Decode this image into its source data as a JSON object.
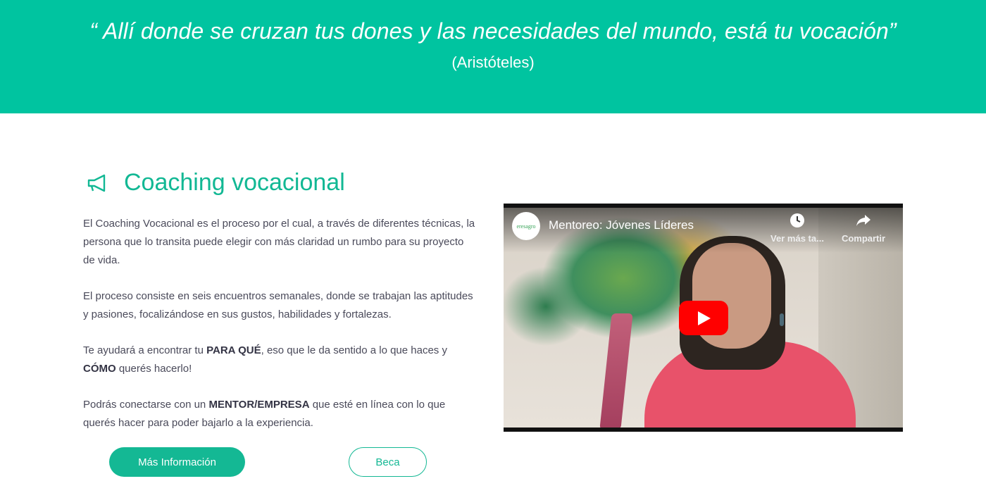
{
  "banner": {
    "quote": "“ Allí  donde se cruzan tus dones y las necesidades del mundo, está tu vocación”",
    "author": "(Aristóteles)",
    "color": "#00c4a0"
  },
  "section": {
    "icon": "megaphone-icon",
    "title": "Coaching vocacional",
    "p1": "El Coaching Vocacional es el proceso por el cual, a través de diferentes técnicas, la persona que lo transita puede elegir con más claridad un rumbo para su proyecto de vida.",
    "p2": "El proceso consiste en seis encuentros semanales, donde se trabajan las aptitudes y pasiones, focalizándose en sus gustos, habilidades y fortalezas.",
    "p3_a": "Te ayudará a encontrar tu ",
    "p3_b": "PARA QUÉ",
    "p3_c": ", eso que le da sentido a lo que haces y ",
    "p3_d": "CÓMO",
    "p3_e": " querés hacerlo!",
    "p4_a": "Podrás conectarse con un ",
    "p4_b": "MENTOR/EMPRESA",
    "p4_c": " que esté en línea con lo que querés hacer para poder bajarlo a la experiencia."
  },
  "buttons": {
    "more_info": "Más Información",
    "beca": "Beca",
    "accent": "#14b894"
  },
  "video": {
    "channel_logo": "eresagro",
    "title": "Mentoreo: Jóvenes Líderes",
    "watch_later": "Ver más ta...",
    "share": "Compartir",
    "play_icon": "play-icon",
    "clock_icon": "clock-icon",
    "share_icon": "share-icon"
  }
}
